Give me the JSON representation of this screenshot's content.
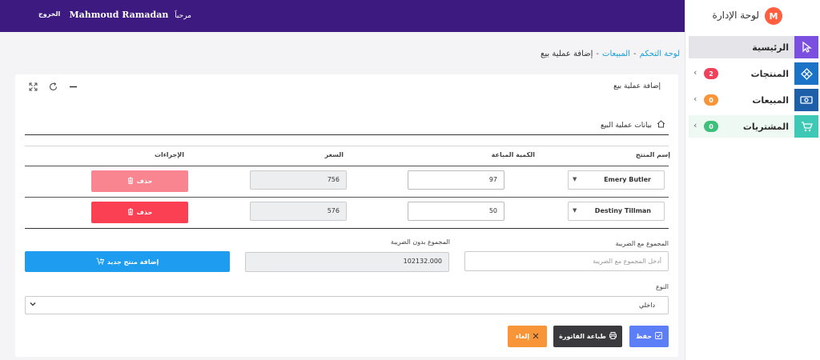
{
  "topbar": {
    "user_name": "Mahmoud Ramadan",
    "greeting": "مرحباً",
    "logout": "الخروج"
  },
  "brand": {
    "logo_letter": "M",
    "title": "لوحة الإدارة"
  },
  "sidebar": {
    "items": [
      {
        "label": "الرئيسية",
        "icon": "cursor-icon",
        "icon_color": "#7b4fe0",
        "badge": ""
      },
      {
        "label": "المنتجات",
        "icon": "layers-icon",
        "icon_color": "#1a73c7",
        "badge": "2",
        "badge_color": "#f0415a"
      },
      {
        "label": "المبيعات",
        "icon": "money-icon",
        "icon_color": "#1d5fa8",
        "badge": "0",
        "badge_color": "#f89539"
      },
      {
        "label": "المشتريات",
        "icon": "cart-icon",
        "icon_color": "#3ec9b6",
        "badge": "0",
        "badge_color": "#3ec07a"
      }
    ]
  },
  "breadcrumb": {
    "home": "لوحة التحكم",
    "sales": "المبيعات",
    "current": "إضافة عملية بيع",
    "sep": "-"
  },
  "card": {
    "title": "إضافة عملية بيع",
    "section_title": "بيانات عملية البيع",
    "table": {
      "headers": {
        "product": "إسم المنتج",
        "qty": "الكمية المباعة",
        "price": "السعر",
        "actions": "الإجراءات"
      },
      "rows": [
        {
          "product": "Emery Butler",
          "qty": "97",
          "price": "756",
          "delete": "حذف"
        },
        {
          "product": "Destiny Tillman",
          "qty": "50",
          "price": "576",
          "delete": "حذف"
        }
      ]
    },
    "total_with_tax_label": "المجموع مع الضريبة",
    "total_with_tax_placeholder": "أدخل المجموع مع الضريبة",
    "total_without_tax_label": "المجموع بدون الضريبة",
    "total_without_tax_value": "102132.000",
    "add_product": "إضافة منتج جديد",
    "type_label": "النوع",
    "type_value": "داخلي",
    "save": "حفظ",
    "print": "طباعة الفاتورة",
    "cancel": "إلغاء"
  }
}
